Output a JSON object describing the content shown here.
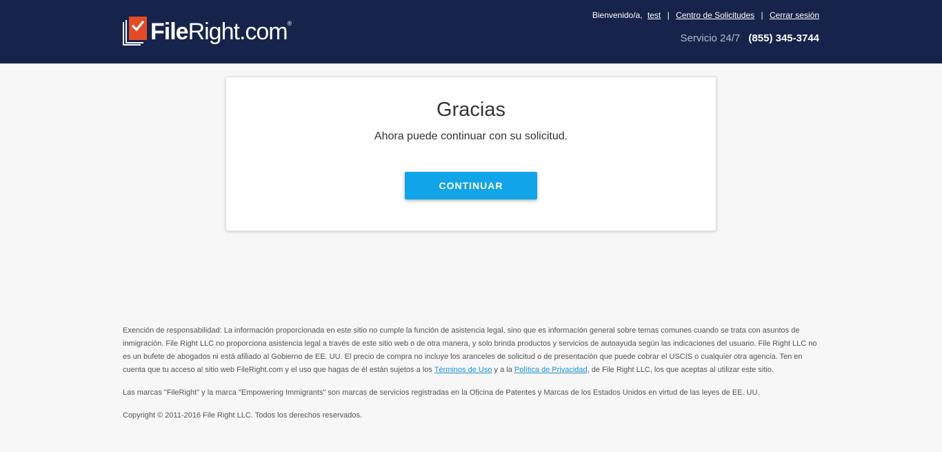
{
  "header": {
    "logo_text_bold": "File",
    "logo_text_rest": "Right.com",
    "logo_reg": "®",
    "welcome": "Bienvenido/a,",
    "username": "test",
    "sep": "|",
    "requests_link": "Centro de Solicitudes",
    "logout_link": "Cerrar sesión",
    "service": "Servicio 24/7",
    "phone": "(855) 345-3744"
  },
  "card": {
    "title": "Gracias",
    "message": "Ahora puede continuar con su solicitud.",
    "button": "CONTINUAR"
  },
  "footer": {
    "disclaimer_a": "Exención de responsabilidad: La información proporcionada en este sitio no cumple la función de asistencia legal, sino que es información general sobre temas comunes cuando se trata con asuntos de inmigración. File Right LLC no proporciona asistencia legal a través de este sitio web o de otra manera, y solo brinda productos y servicios de autoayuda según las indicaciones del usuario. File Right LLC no es un bufete de abogados ni está afiliado al Gobierno de EE. UU. El precio de compra no incluye los aranceles de solicitud o de presentación que puede cobrar el USCIS o cualquier otra agencia. Ten en cuenta que tu acceso al sitio web FileRight.com y el uso que hagas de él están sujetos a los",
    "terms_link": "Términos de Uso",
    "disclaimer_b": "y a la",
    "privacy_link": "Política de Privacidad",
    "disclaimer_c": ", de File Right LLC, los que aceptas al utilizar este sitio.",
    "trademarks": "Las marcas \"FileRight\" y la marca \"Empowering Immigrants\" son marcas de servicios registradas en la Oficina de Patentes y Marcas de los Estados Unidos en virtud de las leyes de EE. UU.",
    "copyright": "Copyright © 2011-2016 File Right LLC. Todos los derechos reservados."
  },
  "colors": {
    "header_bg": "#16234a",
    "logo_red": "#e34b27",
    "button_blue": "#11a4e8",
    "link_blue": "#1b91d6"
  }
}
